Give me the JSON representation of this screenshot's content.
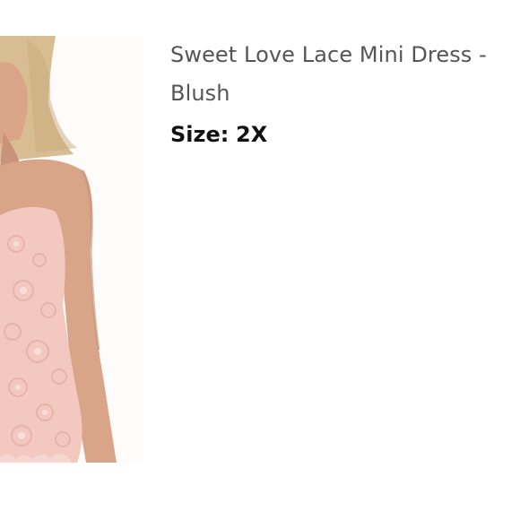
{
  "product": {
    "title": "Sweet Love Lace Mini Dress - Blush",
    "size_label": "Size:",
    "size_value": "2X"
  },
  "image": {
    "alt": "product-photo",
    "colors": {
      "background": "#fdfcfb",
      "hair": "#d8bd93",
      "skin": "#d9a589",
      "dress": "#f2c8bf",
      "lace": "#e7b5ac"
    }
  }
}
